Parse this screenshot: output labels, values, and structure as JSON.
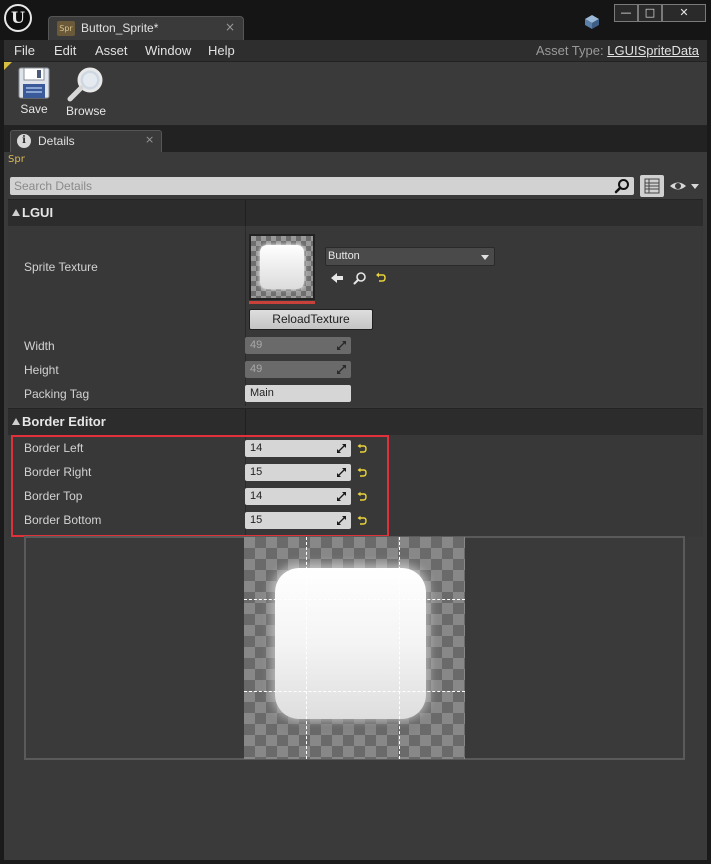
{
  "window": {
    "tab_icon": "Spr",
    "tab_title": "Button_Sprite*",
    "tab_close": "×",
    "minimize": "—",
    "maximize": "□",
    "close": "✕"
  },
  "menu": {
    "items": [
      "File",
      "Edit",
      "Asset",
      "Window",
      "Help"
    ],
    "asset_type_label": "Asset Type:",
    "asset_type_value": "LGUISpriteData"
  },
  "toolbar": {
    "save_label": "Save",
    "browse_label": "Browse"
  },
  "details_tab": {
    "info_glyph": "i",
    "label": "Details",
    "close": "×"
  },
  "details": {
    "object_label": "Spr",
    "search_placeholder": "Search Details",
    "categories": {
      "lgui": "LGUI",
      "border_editor": "Border Editor"
    },
    "sprite_texture": {
      "label": "Sprite Texture",
      "asset": "Button",
      "reload_button": "ReloadTexture"
    },
    "width": {
      "label": "Width",
      "value": "49"
    },
    "height": {
      "label": "Height",
      "value": "49"
    },
    "packing_tag": {
      "label": "Packing Tag",
      "value": "Main"
    },
    "border": {
      "left": {
        "label": "Border Left",
        "value": "14"
      },
      "right": {
        "label": "Border Right",
        "value": "15"
      },
      "top": {
        "label": "Border Top",
        "value": "14"
      },
      "bottom": {
        "label": "Border Bottom",
        "value": "15"
      }
    }
  },
  "colors": {
    "highlight_border": "#e0303a",
    "texture_bar": "#c8413a",
    "panel_bg": "#3a3a3a"
  }
}
